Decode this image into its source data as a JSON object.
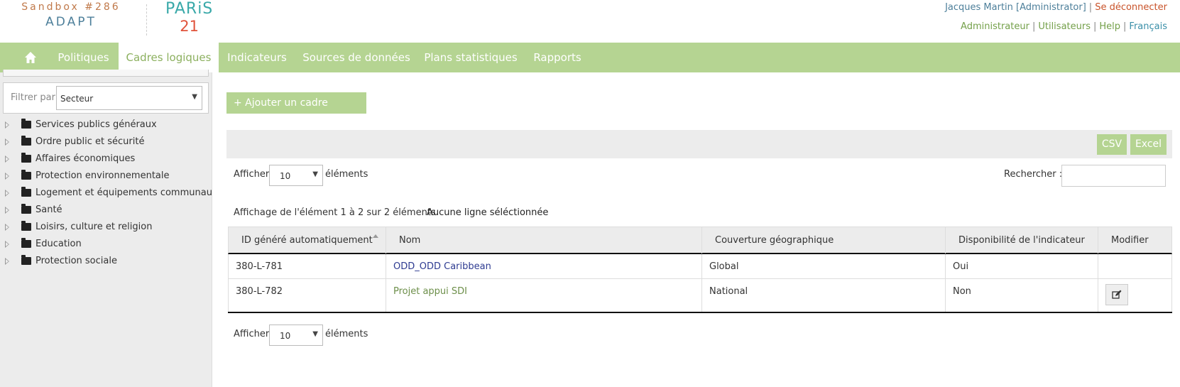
{
  "brand": {
    "sandbox": "Sandbox #286",
    "adapt": "ADAPT",
    "paris_top": "PARiS",
    "paris_bottom": "21"
  },
  "user": {
    "name": "Jacques Martin [Administrator]",
    "logout": "Se déconnecter",
    "links": [
      "Administrateur",
      "Utilisateurs",
      "Help"
    ],
    "language": "Français"
  },
  "nav": {
    "home_icon": "home-icon",
    "items": [
      "Politiques",
      "Cadres logiques",
      "Indicateurs",
      "Sources de données",
      "Plans statistiques",
      "Rapports"
    ],
    "active_index": 1
  },
  "sidebar": {
    "filter_label": "Filtrer par",
    "filter_value": "Secteur",
    "tree": [
      "Services publics généraux",
      "Ordre public et sécurité",
      "Affaires économiques",
      "Protection environnementale",
      "Logement et équipements communautaires",
      "Santé",
      "Loisirs, culture et religion",
      "Education",
      "Protection sociale"
    ]
  },
  "main": {
    "add_button": "+ Ajouter un cadre logique",
    "export": {
      "csv": "CSV",
      "excel": "Excel"
    },
    "length": {
      "prefix": "Afficher",
      "value": "10",
      "suffix": "éléments"
    },
    "search_label": "Rechercher :",
    "search_value": "",
    "info": "Affichage de l'élément 1 à 2 sur 2 éléments",
    "selection_info": "Aucune ligne séléctionnée",
    "table": {
      "columns": [
        "ID généré automatiquement",
        "Nom",
        "Couverture géographique",
        "Disponibilité de l'indicateur",
        "Modifier"
      ],
      "rows": [
        {
          "id": "380-L-781",
          "name": "ODD_ODD Caribbean",
          "coverage": "Global",
          "availability": "Oui",
          "editable": false
        },
        {
          "id": "380-L-782",
          "name": "Projet appui SDI",
          "coverage": "National",
          "availability": "Non",
          "editable": true
        }
      ]
    },
    "length_bottom": {
      "prefix": "Afficher",
      "value": "10",
      "suffix": "éléments"
    }
  },
  "colors": {
    "nav_bg": "#b5d492",
    "active_text": "#8cb05f",
    "link": "#2e3b91"
  }
}
